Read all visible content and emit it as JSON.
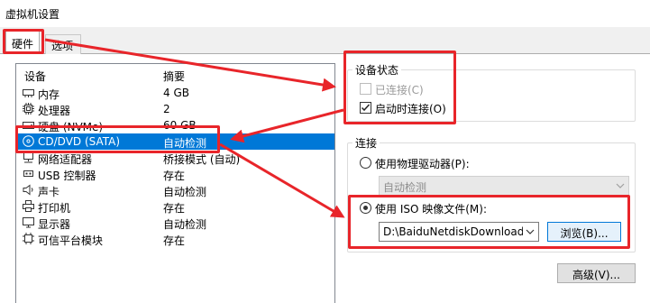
{
  "window": {
    "title": "虚拟机设置"
  },
  "tabs": {
    "hardware": "硬件",
    "options": "选项"
  },
  "device_list": {
    "header": {
      "device": "设备",
      "summary": "摘要"
    },
    "rows": [
      {
        "name": "内存",
        "summary": "4 GB",
        "icon": "memory-icon"
      },
      {
        "name": "处理器",
        "summary": "2",
        "icon": "processor-icon"
      },
      {
        "name": "硬盘 (NVMe)",
        "summary": "60 GB",
        "icon": "hard-disk-icon"
      },
      {
        "name": "CD/DVD (SATA)",
        "summary": "自动检测",
        "icon": "cd-dvd-icon"
      },
      {
        "name": "网络适配器",
        "summary": "桥接模式 (自动)",
        "icon": "network-adapter-icon"
      },
      {
        "name": "USB 控制器",
        "summary": "存在",
        "icon": "usb-icon"
      },
      {
        "name": "声卡",
        "summary": "自动检测",
        "icon": "sound-card-icon"
      },
      {
        "name": "打印机",
        "summary": "存在",
        "icon": "printer-icon"
      },
      {
        "name": "显示器",
        "summary": "自动检测",
        "icon": "display-icon"
      },
      {
        "name": "可信平台模块",
        "summary": "存在",
        "icon": "tpm-icon"
      }
    ]
  },
  "device_status": {
    "legend": "设备状态",
    "connected": "已连接(C)",
    "connect_at_power_on": "启动时连接(O)"
  },
  "connection": {
    "legend": "连接",
    "physical_drive": "使用物理驱动器(P):",
    "physical_drive_value": "自动检测",
    "iso_image": "使用 ISO 映像文件(M):",
    "iso_path": "D:\\BaiduNetdiskDownload\\zh",
    "browse": "浏览(B)..."
  },
  "advanced_button": "高级(V)...",
  "colors": {
    "annotation_red": "#e8252a",
    "selection_blue": "#0078d7"
  }
}
